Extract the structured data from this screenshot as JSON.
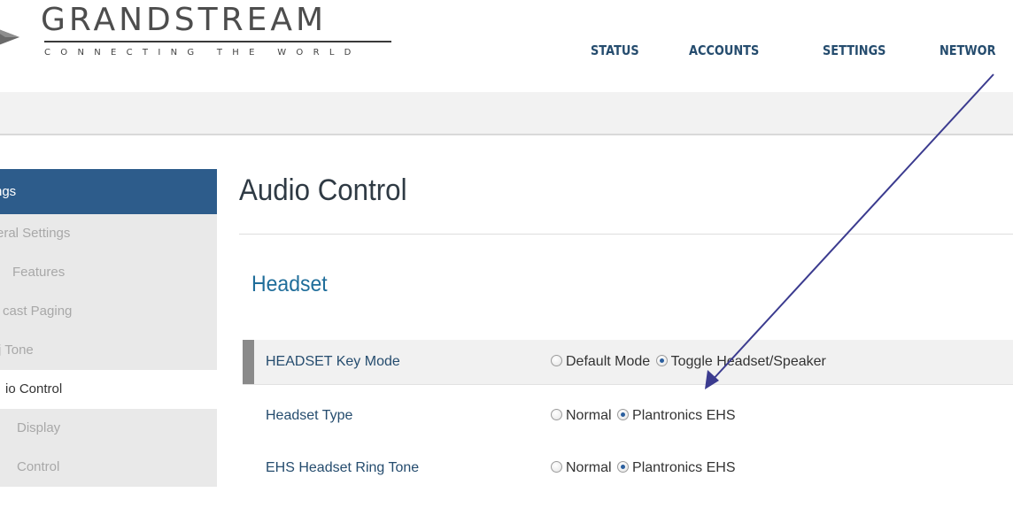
{
  "brand": {
    "name": "GRANDSTREAM",
    "tagline": "CONNECTING THE WORLD"
  },
  "topnav": {
    "items": [
      {
        "label": "STATUS"
      },
      {
        "label": "ACCOUNTS"
      },
      {
        "label": "SETTINGS"
      },
      {
        "label": "NETWOR"
      }
    ]
  },
  "sidebar": {
    "header": "ngs",
    "items": [
      {
        "label": "eral Settings",
        "active": false
      },
      {
        "label": "Features",
        "active": false
      },
      {
        "label": "cast Paging",
        "active": false
      },
      {
        "label": "j Tone",
        "active": false
      },
      {
        "label": "io Control",
        "active": true
      },
      {
        "label": "Display",
        "active": false
      },
      {
        "label": "Control",
        "active": false
      }
    ]
  },
  "main": {
    "title": "Audio Control",
    "section": "Headset",
    "rows": [
      {
        "label": "HEADSET Key Mode",
        "options": [
          {
            "label": "Default Mode",
            "checked": false
          },
          {
            "label": "Toggle Headset/Speaker",
            "checked": true
          }
        ]
      },
      {
        "label": "Headset Type",
        "options": [
          {
            "label": "Normal",
            "checked": false
          },
          {
            "label": "Plantronics EHS",
            "checked": true
          }
        ]
      },
      {
        "label": "EHS Headset Ring Tone",
        "options": [
          {
            "label": "Normal",
            "checked": false
          },
          {
            "label": "Plantronics EHS",
            "checked": true
          }
        ]
      }
    ]
  },
  "colors": {
    "nav_text": "#254c6e",
    "menu_header_bg": "#2d5c8b",
    "section_title": "#1f6d9a",
    "annotation_arrow": "#3b3b8f"
  }
}
